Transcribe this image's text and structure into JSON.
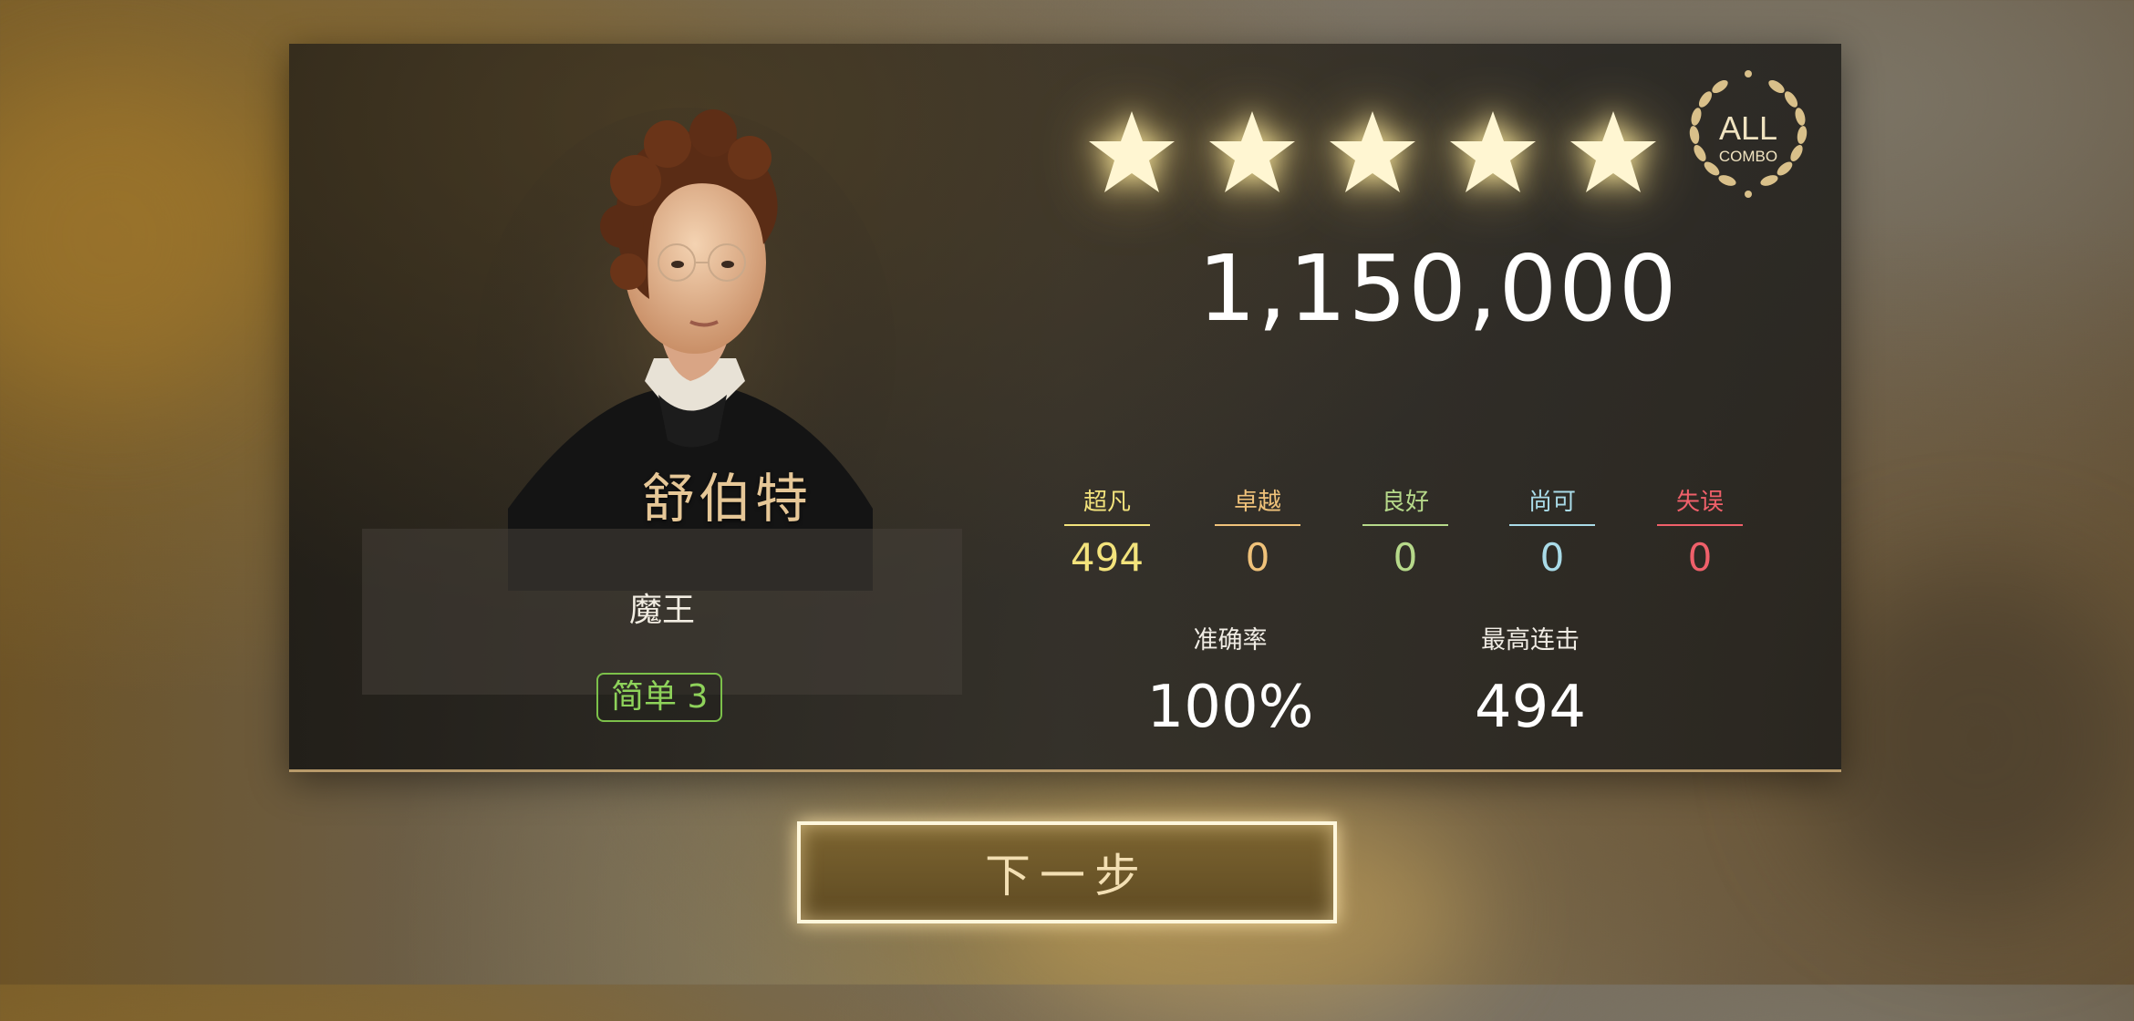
{
  "result": {
    "composer": "舒伯特",
    "song_title": "魔王",
    "difficulty": "简单 3",
    "stars": 5,
    "score": "1,150,000",
    "badge": {
      "line1": "ALL",
      "line2": "COMBO"
    },
    "judgements": [
      {
        "label": "超凡",
        "value": "494",
        "color": "#f3e37c"
      },
      {
        "label": "卓越",
        "value": "0",
        "color": "#f0c27a"
      },
      {
        "label": "良好",
        "value": "0",
        "color": "#b6d98a"
      },
      {
        "label": "尚可",
        "value": "0",
        "color": "#a9dbe8"
      },
      {
        "label": "失误",
        "value": "0",
        "color": "#f0606a"
      }
    ],
    "accuracy": {
      "label": "准确率",
      "value": "100%"
    },
    "max_combo": {
      "label": "最高连击",
      "value": "494"
    }
  },
  "next_button": {
    "label": "下一步"
  },
  "colors": {
    "gold": "#e6c797",
    "panel_border": "#b89a6a",
    "difficulty_green": "#8ed25a"
  }
}
